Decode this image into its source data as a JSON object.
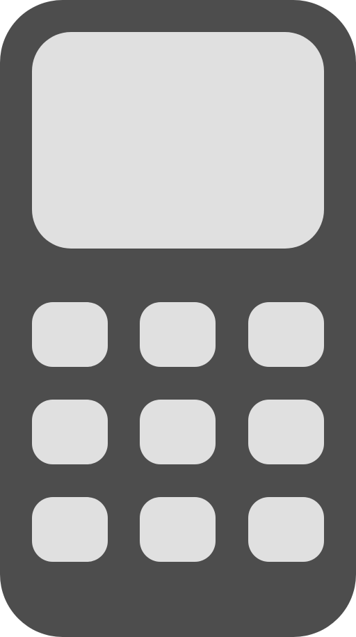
{
  "icon": {
    "name": "mobile-phone-icon",
    "body_color": "#4d4d4d",
    "face_color": "#e0e0e0",
    "keypad": {
      "rows": 3,
      "columns": 3
    }
  }
}
